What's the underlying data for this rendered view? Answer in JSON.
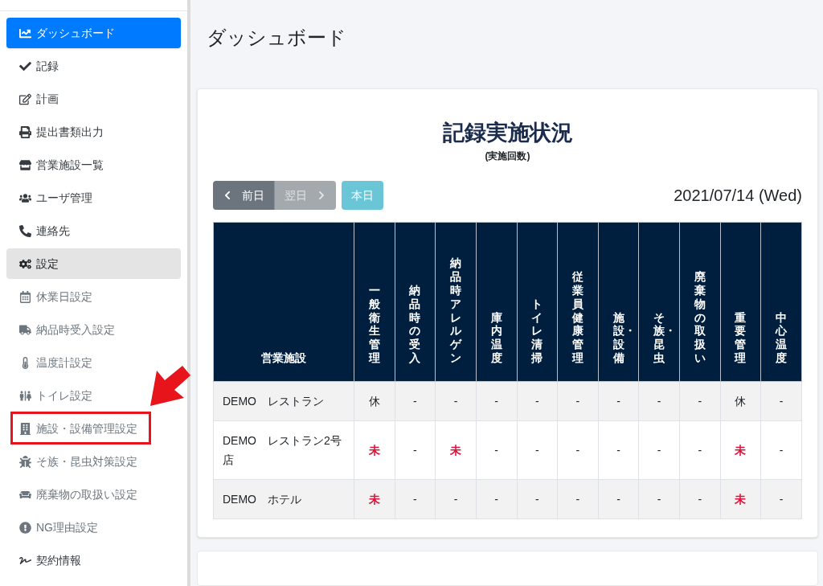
{
  "sidebar": {
    "items": [
      {
        "label": "ダッシュボード",
        "kind": "main",
        "selected": true,
        "expanded": false
      },
      {
        "label": "記録",
        "kind": "main",
        "selected": false,
        "expanded": false
      },
      {
        "label": "計画",
        "kind": "main",
        "selected": false,
        "expanded": false
      },
      {
        "label": "提出書類出力",
        "kind": "main",
        "selected": false,
        "expanded": false
      },
      {
        "label": "営業施設一覧",
        "kind": "main",
        "selected": false,
        "expanded": false
      },
      {
        "label": "ユーザ管理",
        "kind": "main",
        "selected": false,
        "expanded": false
      },
      {
        "label": "連絡先",
        "kind": "main",
        "selected": false,
        "expanded": false
      },
      {
        "label": "設定",
        "kind": "main",
        "selected": false,
        "expanded": true
      },
      {
        "label": "休業日設定",
        "kind": "sub",
        "annotated": false
      },
      {
        "label": "納品時受入設定",
        "kind": "sub",
        "annotated": false
      },
      {
        "label": "温度計設定",
        "kind": "sub",
        "annotated": false
      },
      {
        "label": "トイレ設定",
        "kind": "sub",
        "annotated": false
      },
      {
        "label": "施設・設備管理設定",
        "kind": "sub",
        "annotated": true
      },
      {
        "label": "そ族・昆虫対策設定",
        "kind": "sub",
        "annotated": false
      },
      {
        "label": "廃棄物の取扱い設定",
        "kind": "sub",
        "annotated": false
      },
      {
        "label": "NG理由設定",
        "kind": "sub",
        "annotated": false
      },
      {
        "label": "契約情報",
        "kind": "main",
        "selected": false,
        "expanded": false
      }
    ]
  },
  "page_title": "ダッシュボード",
  "card": {
    "title": "記録実施状況",
    "subtitle": "(実施回数)",
    "nav": {
      "prev": "前日",
      "next": "翌日",
      "today": "本日",
      "next_disabled": true
    },
    "date": "2021/07/14 (Wed)",
    "table": {
      "columns": [
        "営業施設",
        "一般衛生管理",
        "納品時の受入",
        "納品時アレルゲン",
        "庫内温度",
        "トイレ清掃",
        "従業員健康管理",
        "施設・設備",
        "そ族・昆虫",
        "廃棄物の取扱い",
        "重要管理",
        "中心温度"
      ],
      "rows": [
        {
          "cells": [
            {
              "text": "DEMO　レストラン",
              "kind": "facility"
            },
            {
              "text": "休",
              "kind": "closed"
            },
            {
              "text": "-",
              "kind": "none"
            },
            {
              "text": "-",
              "kind": "none"
            },
            {
              "text": "-",
              "kind": "none"
            },
            {
              "text": "-",
              "kind": "none"
            },
            {
              "text": "-",
              "kind": "none"
            },
            {
              "text": "-",
              "kind": "none"
            },
            {
              "text": "-",
              "kind": "none"
            },
            {
              "text": "-",
              "kind": "none"
            },
            {
              "text": "休",
              "kind": "closed"
            },
            {
              "text": "-",
              "kind": "none"
            }
          ]
        },
        {
          "cells": [
            {
              "text": "DEMO　レストラン2号店",
              "kind": "facility"
            },
            {
              "text": "未",
              "kind": "pending"
            },
            {
              "text": "-",
              "kind": "none"
            },
            {
              "text": "未",
              "kind": "pending"
            },
            {
              "text": "-",
              "kind": "none"
            },
            {
              "text": "-",
              "kind": "none"
            },
            {
              "text": "-",
              "kind": "none"
            },
            {
              "text": "-",
              "kind": "none"
            },
            {
              "text": "-",
              "kind": "none"
            },
            {
              "text": "-",
              "kind": "none"
            },
            {
              "text": "未",
              "kind": "pending"
            },
            {
              "text": "-",
              "kind": "none"
            }
          ]
        },
        {
          "cells": [
            {
              "text": "DEMO　ホテル",
              "kind": "facility"
            },
            {
              "text": "未",
              "kind": "pending"
            },
            {
              "text": "-",
              "kind": "none"
            },
            {
              "text": "-",
              "kind": "none"
            },
            {
              "text": "-",
              "kind": "none"
            },
            {
              "text": "-",
              "kind": "none"
            },
            {
              "text": "-",
              "kind": "none"
            },
            {
              "text": "-",
              "kind": "none"
            },
            {
              "text": "-",
              "kind": "none"
            },
            {
              "text": "-",
              "kind": "none"
            },
            {
              "text": "未",
              "kind": "pending"
            },
            {
              "text": "-",
              "kind": "none"
            }
          ]
        }
      ]
    }
  }
}
